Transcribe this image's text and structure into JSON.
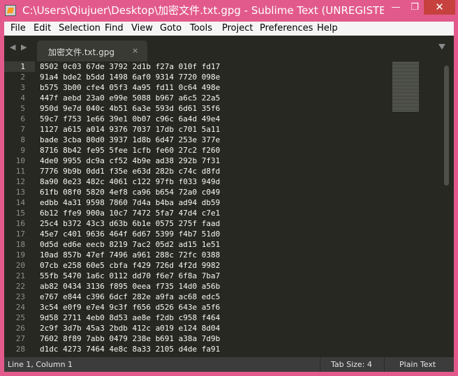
{
  "window": {
    "title": "C:\\Users\\Qiujuer\\Desktop\\加密文件.txt.gpg - Sublime Text (UNREGISTERED)",
    "minimize": "—",
    "maximize": "❐",
    "close": "✕"
  },
  "menu": {
    "file": "File",
    "edit": "Edit",
    "selection": "Selection",
    "find": "Find",
    "view": "View",
    "goto": "Goto",
    "tools": "Tools",
    "project": "Project",
    "preferences": "Preferences",
    "help": "Help"
  },
  "tabs": {
    "nav_left": "◀",
    "nav_right": "▶",
    "active_label": "加密文件.txt.gpg",
    "close": "×"
  },
  "editor": {
    "lines": [
      "8502 0c03 67de 3792 2d1b f27a 010f fd17",
      "91a4 bde2 b5dd 1498 6af0 9314 7720 098e",
      "b575 3b00 cfe4 05f3 4a95 fd11 0c64 498e",
      "447f aebd 23a0 e99e 5088 b967 a6c5 22a5",
      "950d 9e7d 040c 4b51 6a3e 593d 6d61 35f6",
      "59c7 f753 1e66 39e1 0b07 c96c 6a4d 49e4",
      "1127 a615 a014 9376 7037 17db c701 5a11",
      "bade 3cba 80d0 3937 1d8b 6d47 253e 377e",
      "8716 8b42 fe95 5fee 1cfb fe60 27c2 f260",
      "4de0 9955 dc9a cf52 4b9e ad38 292b 7f31",
      "7776 9b9b 0dd1 f35e e63d 282b c74c d8fd",
      "8a90 0e23 482c 4061 c122 97fb f033 949d",
      "61fb 08f0 5820 4ef8 ca96 b654 72a0 c049",
      "edbb 4a31 9598 7860 7d4a b4ba ad94 db59",
      "6b12 ffe9 900a 10c7 7472 5fa7 47d4 c7e1",
      "25c4 b372 43c3 d63b 6b1e 0575 275f faad",
      "45e7 c401 9636 464f 6d67 5399 f4b7 51d0",
      "0d5d ed6e eecb 8219 7ac2 05d2 ad15 1e51",
      "10ad 857b 47ef 7496 a961 288c 72fc 0388",
      "07cb e258 60e5 cbfa f429 726d 4f2d 9982",
      "55fb 5470 1a6c 0112 dd70 f6e7 6f8a 7ba7",
      "ab82 0434 3136 f895 0eea f735 14d0 a56b",
      "e767 e844 c396 6dcf 282e a9fa ac68 edc5",
      "3c54 e0f9 e7e4 9c3f f656 d526 643e a5f6",
      "9d58 2711 4eb0 8d53 ae8e f2db c958 f464",
      "2c9f 3d7b 45a3 2bdb 412c a019 e124 8d04",
      "7602 8f89 7abb 0479 238e b691 a38a 7d9b",
      "d1dc 4273 7464 4e8c 8a33 2105 d4de fa91"
    ]
  },
  "status": {
    "position": "Line 1, Column 1",
    "tab_size": "Tab Size: 4",
    "syntax": "Plain Text"
  }
}
